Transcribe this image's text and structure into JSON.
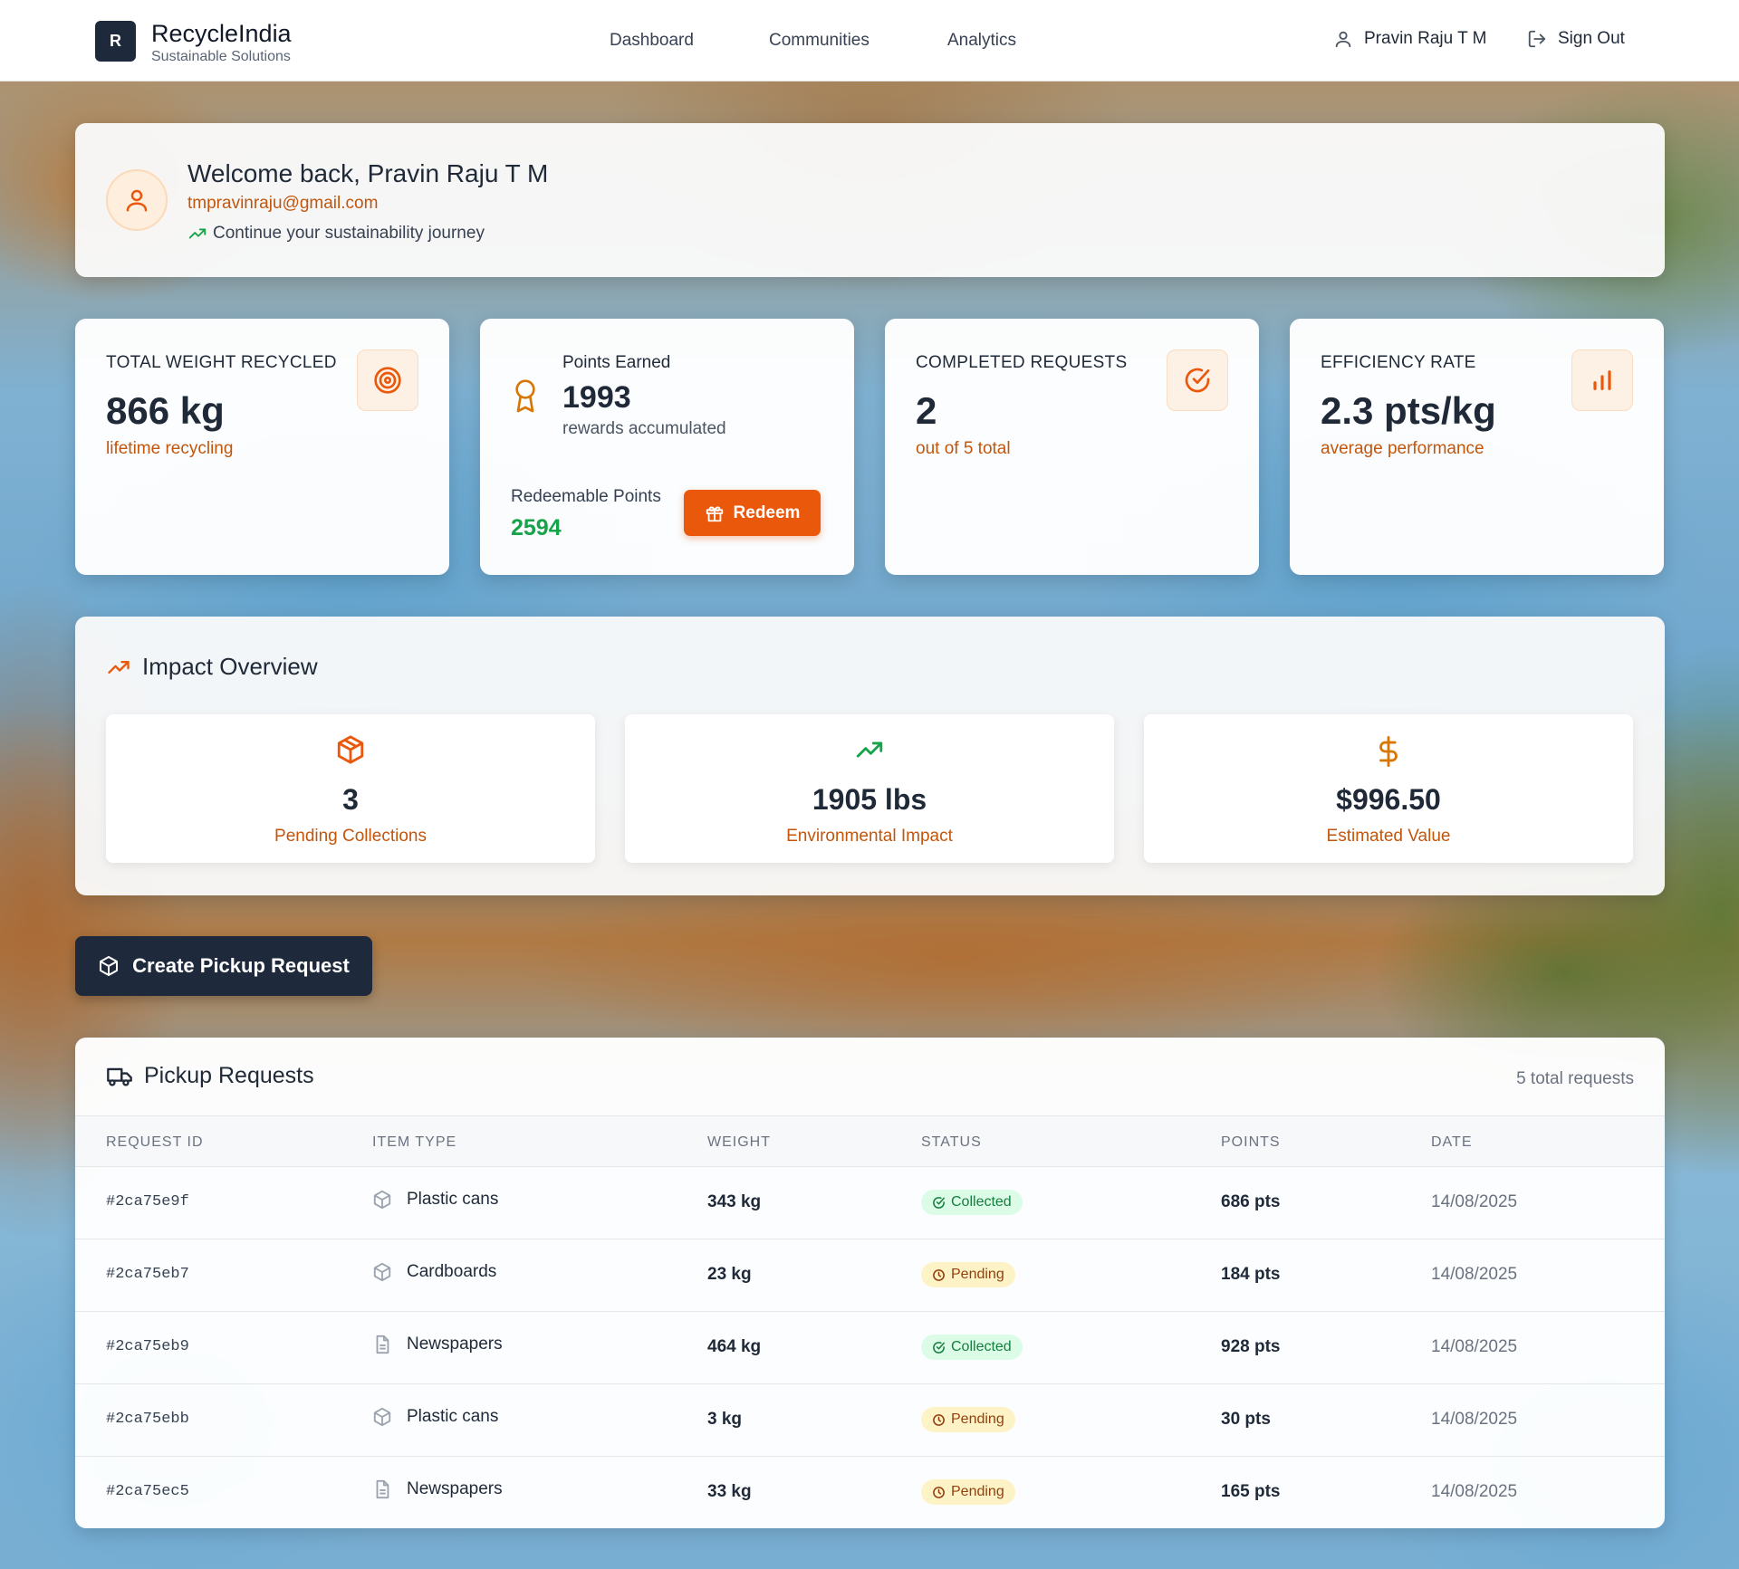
{
  "header": {
    "logo_letter": "R",
    "brand": "RecycleIndia",
    "tagline": "Sustainable Solutions",
    "nav": [
      "Dashboard",
      "Communities",
      "Analytics"
    ],
    "user_name": "Pravin Raju T M",
    "sign_out": "Sign Out"
  },
  "welcome": {
    "title": "Welcome back, Pravin Raju T M",
    "email": "tmpravinraju@gmail.com",
    "subtitle": "Continue your sustainability journey"
  },
  "stats": {
    "weight": {
      "label": "TOTAL WEIGHT RECYCLED",
      "value": "866 kg",
      "sub": "lifetime recycling",
      "icon": "target-icon"
    },
    "points": {
      "label": "Points Earned",
      "value": "1993",
      "sub": "rewards accumulated",
      "icon": "award-icon",
      "redeemable_label": "Redeemable Points",
      "redeemable_value": "2594",
      "redeem_button": "Redeem"
    },
    "completed": {
      "label": "COMPLETED REQUESTS",
      "value": "2",
      "sub": "out of 5 total",
      "icon": "check-circle-icon"
    },
    "efficiency": {
      "label": "EFFICIENCY RATE",
      "value": "2.3 pts/kg",
      "sub": "average performance",
      "icon": "bar-chart-icon"
    }
  },
  "impact": {
    "title": "Impact Overview",
    "tiles": [
      {
        "value": "3",
        "label": "Pending Collections",
        "icon": "package-icon"
      },
      {
        "value": "1905 lbs",
        "label": "Environmental Impact",
        "icon": "trending-up-icon"
      },
      {
        "value": "$996.50",
        "label": "Estimated Value",
        "icon": "dollar-icon"
      }
    ]
  },
  "create_button": "Create Pickup Request",
  "requests": {
    "title": "Pickup Requests",
    "total": "5 total requests",
    "columns": [
      "REQUEST ID",
      "ITEM TYPE",
      "WEIGHT",
      "STATUS",
      "POINTS",
      "DATE"
    ],
    "rows": [
      {
        "id": "#2ca75e9f",
        "item": "Plastic cans",
        "weight": "343 kg",
        "status": "Collected",
        "points": "686 pts",
        "date": "14/08/2025"
      },
      {
        "id": "#2ca75eb7",
        "item": "Cardboards",
        "weight": "23 kg",
        "status": "Pending",
        "points": "184 pts",
        "date": "14/08/2025"
      },
      {
        "id": "#2ca75eb9",
        "item": "Newspapers",
        "weight": "464 kg",
        "status": "Collected",
        "points": "928 pts",
        "date": "14/08/2025"
      },
      {
        "id": "#2ca75ebb",
        "item": "Plastic cans",
        "weight": "3 kg",
        "status": "Pending",
        "points": "30 pts",
        "date": "14/08/2025"
      },
      {
        "id": "#2ca75ec5",
        "item": "Newspapers",
        "weight": "33 kg",
        "status": "Pending",
        "points": "165 pts",
        "date": "14/08/2025"
      }
    ]
  },
  "colors": {
    "accent": "#ea580c",
    "dark": "#1e293b",
    "success": "#16a34a",
    "pending": "#92400e"
  }
}
